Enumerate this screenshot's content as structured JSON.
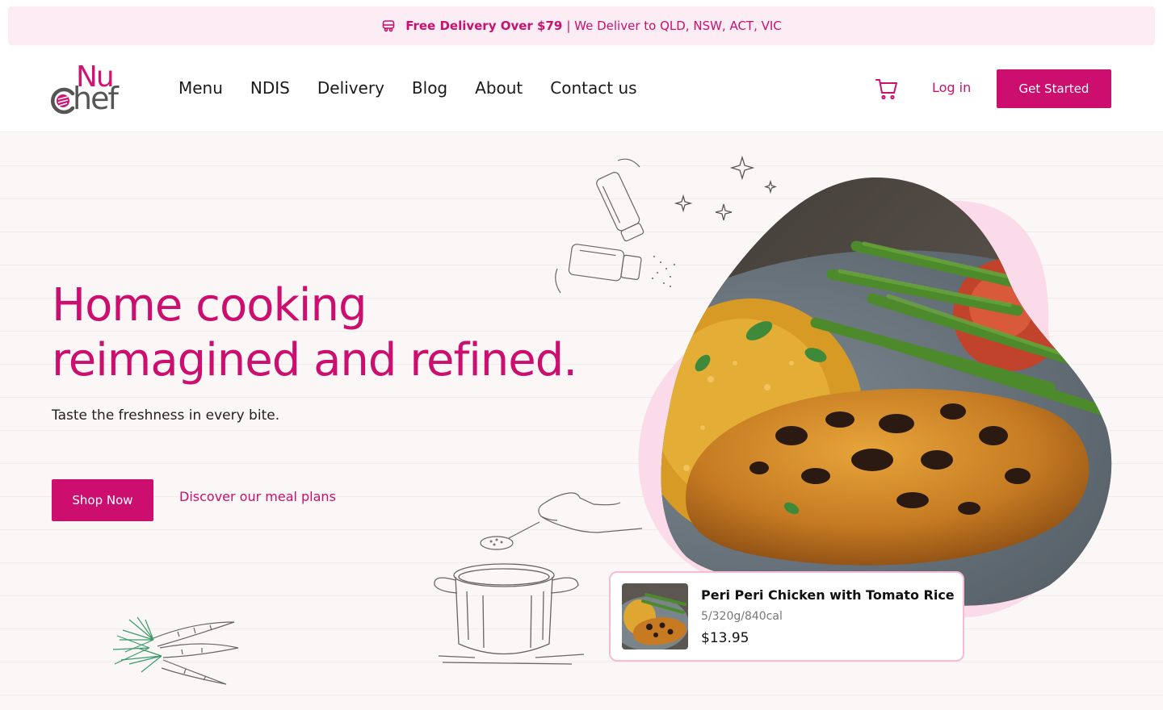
{
  "promo": {
    "bold": "Free Delivery Over $79",
    "rest": "| We Deliver to QLD, NSW, ACT, VIC",
    "icon": "truck-icon"
  },
  "brand": {
    "nu": "Nu",
    "chef": "hef",
    "accent": "#cc0f6f"
  },
  "nav": {
    "items": [
      "Menu",
      "NDIS",
      "Delivery",
      "Blog",
      "About",
      "Contact us"
    ],
    "cart_icon": "cart-icon",
    "login": "Log in",
    "cta": "Get Started"
  },
  "hero": {
    "headline_line1": "Home cooking",
    "headline_line2": "reimagined and refined.",
    "subtitle": "Taste the freshness in every bite.",
    "primary_button": "Shop Now",
    "secondary_link": "Discover our meal plans"
  },
  "product": {
    "name": "Peri Peri Chicken with Tomato Rice",
    "meta": "5/320g/840cal",
    "price": "$13.95"
  }
}
